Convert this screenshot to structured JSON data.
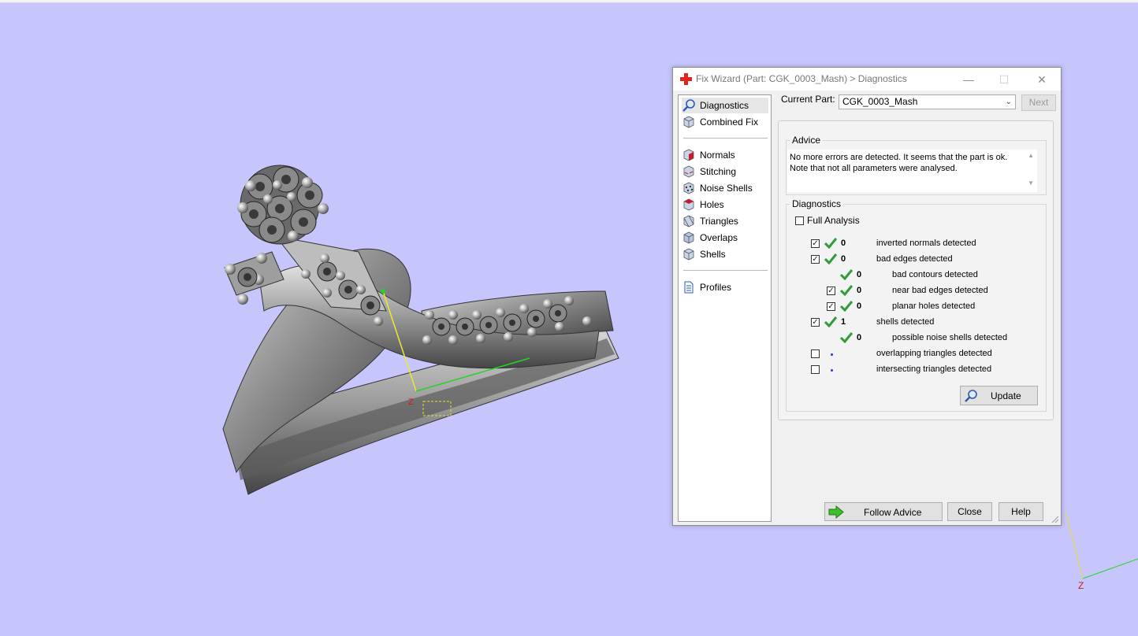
{
  "dialog": {
    "title": "Fix Wizard (Part: CGK_0003_Mash) > Diagnostics",
    "window_buttons": {
      "minimize": "—",
      "maximize": "☐",
      "close": "✕"
    },
    "current_part_label": "Current Part:",
    "current_part_value": "CGK_0003_Mash",
    "next_label": "Next",
    "advice": {
      "title": "Advice",
      "text": "No more errors are detected. It seems that the part is ok. Note that not all parameters were analysed."
    },
    "diagnostics": {
      "title": "Diagnostics",
      "full_analysis_label": "Full Analysis",
      "items": [
        {
          "checked": true,
          "status": "ok",
          "count": "0",
          "label": "inverted normals detected",
          "indent": false
        },
        {
          "checked": true,
          "status": "ok",
          "count": "0",
          "label": "bad edges detected",
          "indent": false
        },
        {
          "checked": null,
          "status": "ok",
          "count": "0",
          "label": "bad contours detected",
          "indent": true
        },
        {
          "checked": true,
          "status": "ok",
          "count": "0",
          "label": "near bad edges detected",
          "indent": true
        },
        {
          "checked": true,
          "status": "ok",
          "count": "0",
          "label": "planar holes detected",
          "indent": true
        },
        {
          "checked": true,
          "status": "ok",
          "count": "1",
          "label": "shells detected",
          "indent": false
        },
        {
          "checked": null,
          "status": "ok",
          "count": "0",
          "label": "possible noise shells detected",
          "indent": true
        },
        {
          "checked": false,
          "status": "pending",
          "count": "",
          "label": "overlapping triangles detected",
          "indent": false
        },
        {
          "checked": false,
          "status": "pending",
          "count": "",
          "label": "intersecting triangles detected",
          "indent": false
        }
      ],
      "update_label": "Update"
    },
    "buttons": {
      "follow_advice": "Follow Advice",
      "close": "Close",
      "help": "Help"
    },
    "nav": {
      "group1": [
        {
          "label": "Diagnostics",
          "icon": "magnifier-icon",
          "selected": true
        },
        {
          "label": "Combined Fix",
          "icon": "cube-icon",
          "selected": false
        }
      ],
      "group2": [
        {
          "label": "Normals",
          "icon": "normals-cube-icon"
        },
        {
          "label": "Stitching",
          "icon": "stitching-cube-icon"
        },
        {
          "label": "Noise Shells",
          "icon": "noise-shells-icon"
        },
        {
          "label": "Holes",
          "icon": "holes-cube-icon"
        },
        {
          "label": "Triangles",
          "icon": "triangles-cube-icon"
        },
        {
          "label": "Overlaps",
          "icon": "overlaps-cube-icon"
        },
        {
          "label": "Shells",
          "icon": "shells-cube-icon"
        }
      ],
      "group3": [
        {
          "label": "Profiles",
          "icon": "profiles-document-icon"
        }
      ]
    }
  },
  "viewport": {
    "background": "#c6c6fc",
    "origin_axis_label": "Z",
    "corner_axis_label": "Z"
  },
  "colors": {
    "check_green": "#2e9c3a",
    "close_red": "#e0261c",
    "dot_blue": "#2f4bd8"
  }
}
